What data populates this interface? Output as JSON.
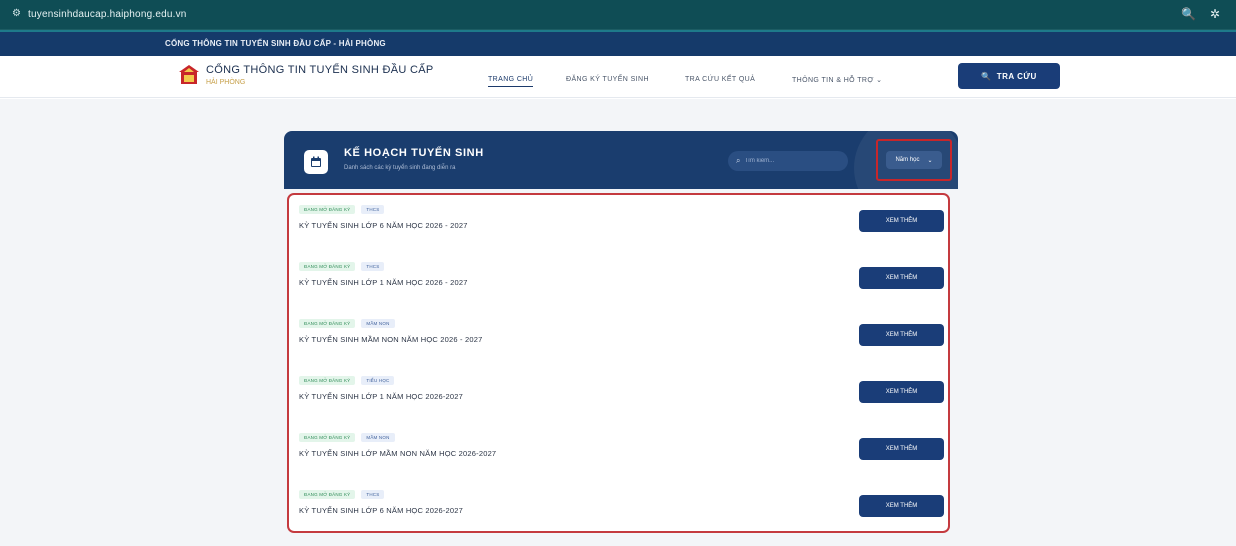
{
  "browser": {
    "url": "tuyensinhdaucap.haiphong.edu.vn"
  },
  "top_strip": {
    "text": "CỔNG THÔNG TIN TUYỂN SINH ĐẦU CẤP - HẢI PHÒNG"
  },
  "header": {
    "brand_title": "CỔNG THÔNG TIN TUYỂN SINH ĐẦU CẤP",
    "brand_subtitle": "HẢI PHÒNG",
    "nav": [
      "TRANG CHỦ",
      "ĐĂNG KÝ TUYỂN SINH",
      "TRA CỨU KẾT QUẢ",
      "THÔNG TIN & HỖ TRỢ"
    ],
    "search_button": "TRA CỨU"
  },
  "panel": {
    "title": "KẾ HOẠCH TUYỂN SINH",
    "subtitle": "Danh sách các kỳ tuyển sinh đang diễn ra",
    "search_placeholder": "Tìm kiếm...",
    "year_select": "Năm học"
  },
  "rows": [
    {
      "status": "ĐANG MỞ ĐĂNG KÝ",
      "level": "THCS",
      "name": "KỲ TUYỂN SINH LỚP 6 NĂM HỌC 2026 - 2027",
      "button": "XEM THÊM"
    },
    {
      "status": "ĐANG MỞ ĐĂNG KÝ",
      "level": "THCS",
      "name": "KỲ TUYỂN SINH LỚP 1 NĂM HỌC 2026 - 2027",
      "button": "XEM THÊM"
    },
    {
      "status": "ĐANG MỞ ĐĂNG KÝ",
      "level": "MẦM NON",
      "name": "KỲ TUYỂN SINH MẦM NON NĂM HỌC 2026 - 2027",
      "button": "XEM THÊM"
    },
    {
      "status": "ĐANG MỞ ĐĂNG KÝ",
      "level": "TIỂU HỌC",
      "name": "KỲ TUYỂN SINH LỚP 1 NĂM HỌC 2026-2027",
      "button": "XEM THÊM"
    },
    {
      "status": "ĐANG MỞ ĐĂNG KÝ",
      "level": "MẦM NON",
      "name": "KỲ TUYỂN SINH LỚP MẦM NON NĂM HỌC 2026-2027",
      "button": "XEM THÊM"
    },
    {
      "status": "ĐANG MỞ ĐĂNG KÝ",
      "level": "THCS",
      "name": "KỲ TUYỂN SINH LỚP 6 NĂM HỌC 2026-2027",
      "button": "XEM THÊM"
    }
  ],
  "icons": {
    "site": "site-info-icon",
    "zoom": "zoom-icon",
    "extension": "extension-icon",
    "logo": "school-logo-icon",
    "search": "search-icon",
    "calendar": "calendar-icon",
    "chevron": "chevron-down-icon"
  },
  "colors": {
    "primary": "#1a3d78",
    "panel_header": "#1a3d6e",
    "highlight_border": "#c43a3f",
    "status_badge": "#2e8b57"
  }
}
